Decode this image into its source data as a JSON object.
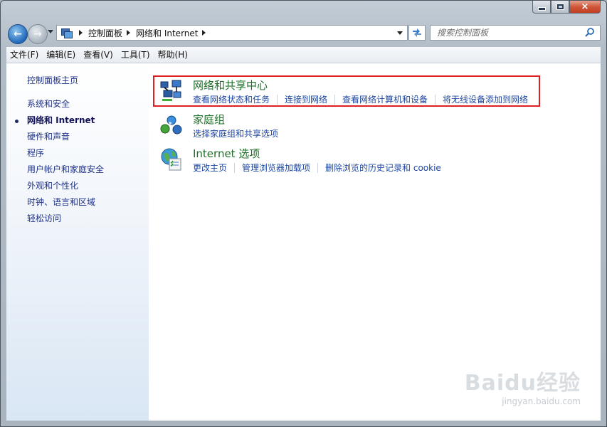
{
  "window": {
    "caption_buttons": {
      "minimize": "minimize",
      "maximize": "maximize",
      "close": "×"
    }
  },
  "navigation": {
    "breadcrumb": [
      "控制面板",
      "网络和 Internet"
    ],
    "search_placeholder": "搜索控制面板"
  },
  "menubar": {
    "items": [
      "文件(F)",
      "编辑(E)",
      "查看(V)",
      "工具(T)",
      "帮助(H)"
    ]
  },
  "sidebar": {
    "home": "控制面板主页",
    "items": [
      "系统和安全",
      "网络和 Internet",
      "硬件和声音",
      "程序",
      "用户帐户和家庭安全",
      "外观和个性化",
      "时钟、语言和区域",
      "轻松访问"
    ],
    "current_index": 1
  },
  "categories": [
    {
      "title": "网络和共享中心",
      "icon": "network-sharing-center-icon",
      "links": [
        "查看网络状态和任务",
        "连接到网络",
        "查看网络计算机和设备",
        "将无线设备添加到网络"
      ],
      "highlighted": true
    },
    {
      "title": "家庭组",
      "icon": "homegroup-icon",
      "links": [
        "选择家庭组和共享选项"
      ]
    },
    {
      "title": "Internet 选项",
      "icon": "internet-options-icon",
      "links": [
        "更改主页",
        "管理浏览器加载项",
        "删除浏览的历史记录和 cookie"
      ]
    }
  ],
  "watermark": {
    "brand": "Baidu经验",
    "url": "jingyan.baidu.com"
  },
  "colors": {
    "highlight_border": "#e02020",
    "category_title": "#1e6e28",
    "link": "#1e46a0",
    "sidebar_link": "#1e3287"
  }
}
